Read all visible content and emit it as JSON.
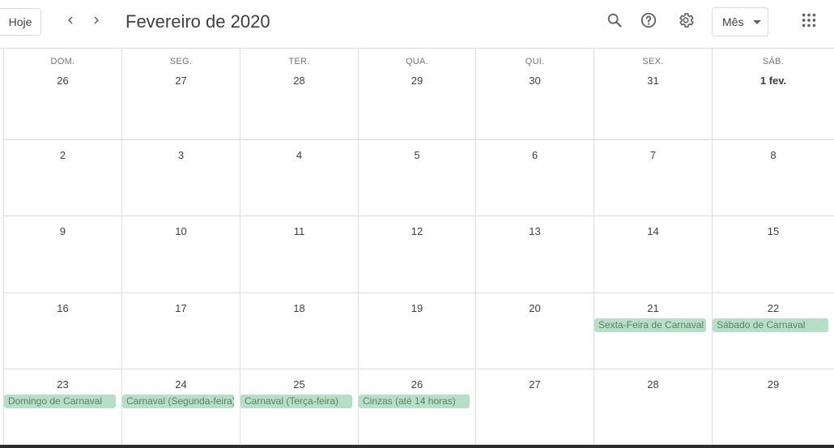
{
  "header": {
    "today_label": "Hoje",
    "title": "Fevereiro de 2020",
    "view_label": "Mês"
  },
  "icons": {
    "prev": "chevron-left-icon",
    "next": "chevron-right-icon",
    "search": "search-icon",
    "help": "help-icon",
    "settings": "gear-icon",
    "apps": "apps-grid-icon"
  },
  "colors": {
    "event_bg": "#b7dfc6",
    "event_text": "#5f7e6e",
    "grid_line": "#dadce0"
  },
  "weekdays": [
    "DOM.",
    "SEG.",
    "TER.",
    "QUA.",
    "QUI.",
    "SEX.",
    "SÁB."
  ],
  "weeks": [
    {
      "dates": [
        "26",
        "27",
        "28",
        "29",
        "30",
        "31",
        "1 fev."
      ],
      "events": []
    },
    {
      "dates": [
        "2",
        "3",
        "4",
        "5",
        "6",
        "7",
        "8"
      ],
      "events": []
    },
    {
      "dates": [
        "9",
        "10",
        "11",
        "12",
        "13",
        "14",
        "15"
      ],
      "events": []
    },
    {
      "dates": [
        "16",
        "17",
        "18",
        "19",
        "20",
        "21",
        "22"
      ],
      "events": [
        {
          "day": 5,
          "label": "Sexta-Feira de Carnaval"
        },
        {
          "day": 6,
          "label": "Sábado de Carnaval"
        }
      ]
    },
    {
      "dates": [
        "23",
        "24",
        "25",
        "26",
        "27",
        "28",
        "29"
      ],
      "events": [
        {
          "day": 0,
          "label": "Domingo de Carnaval"
        },
        {
          "day": 1,
          "label": "Carnaval (Segunda-feira)"
        },
        {
          "day": 2,
          "label": "Carnaval (Terça-feira)"
        },
        {
          "day": 3,
          "label": "Cinzas (até 14 horas)"
        }
      ]
    }
  ]
}
